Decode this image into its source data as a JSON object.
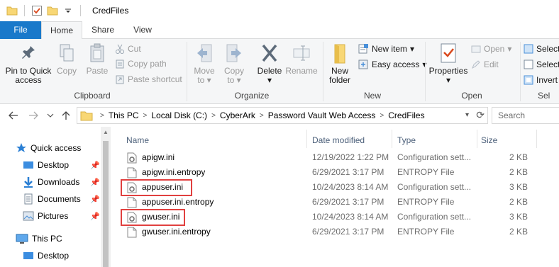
{
  "window": {
    "title": "CredFiles"
  },
  "quick_access_toolbar": {
    "icons": [
      "folder-icon",
      "properties-check-icon",
      "new-folder-icon",
      "customize-dropdown-icon"
    ]
  },
  "tabs": {
    "file": "File",
    "home": "Home",
    "share": "Share",
    "view": "View"
  },
  "ribbon": {
    "clipboard": {
      "label": "Clipboard",
      "pin": "Pin to Quick\naccess",
      "pin_1": "Pin to Quick",
      "pin_2": "access",
      "copy": "Copy",
      "paste": "Paste",
      "cut": "Cut",
      "copy_path": "Copy path",
      "paste_shortcut": "Paste shortcut"
    },
    "organize": {
      "label": "Organize",
      "move_to_1": "Move",
      "move_to_2": "to",
      "copy_to_1": "Copy",
      "copy_to_2": "to",
      "delete": "Delete",
      "rename": "Rename"
    },
    "new": {
      "label": "New",
      "new_folder_1": "New",
      "new_folder_2": "folder",
      "new_item": "New item",
      "easy_access": "Easy access"
    },
    "open": {
      "label": "Open",
      "properties": "Properties",
      "open": "Open",
      "edit": "Edit"
    },
    "select": {
      "label": "Sel",
      "select_all": "Select",
      "select_none": "Select",
      "invert": "Invert"
    }
  },
  "address": {
    "crumbs": [
      "This PC",
      "Local Disk (C:)",
      "CyberArk",
      "Password Vault Web Access",
      "CredFiles"
    ],
    "search_placeholder": "Search CredFiles"
  },
  "nav": {
    "quick_access": "Quick access",
    "desktop": "Desktop",
    "downloads": "Downloads",
    "documents": "Documents",
    "pictures": "Pictures",
    "this_pc": "This PC",
    "desktop2": "Desktop"
  },
  "columns": {
    "name": "Name",
    "date": "Date modified",
    "type": "Type",
    "size": "Size"
  },
  "files": [
    {
      "name": "apigw.ini",
      "date": "12/19/2022 1:22 PM",
      "type": "Configuration sett...",
      "size": "2 KB",
      "icon": "config-file-icon"
    },
    {
      "name": "apigw.ini.entropy",
      "date": "6/29/2021 3:17 PM",
      "type": "ENTROPY File",
      "size": "2 KB",
      "icon": "blank-file-icon"
    },
    {
      "name": "appuser.ini",
      "date": "10/24/2023 8:14 AM",
      "type": "Configuration sett...",
      "size": "3 KB",
      "icon": "config-file-icon"
    },
    {
      "name": "appuser.ini.entropy",
      "date": "6/29/2021 3:17 PM",
      "type": "ENTROPY File",
      "size": "2 KB",
      "icon": "blank-file-icon"
    },
    {
      "name": "gwuser.ini",
      "date": "10/24/2023 8:14 AM",
      "type": "Configuration sett...",
      "size": "3 KB",
      "icon": "config-file-icon"
    },
    {
      "name": "gwuser.ini.entropy",
      "date": "6/29/2021 3:17 PM",
      "type": "ENTROPY File",
      "size": "2 KB",
      "icon": "blank-file-icon"
    }
  ],
  "highlight_color": "#e1403f",
  "accent": "#1979ca"
}
